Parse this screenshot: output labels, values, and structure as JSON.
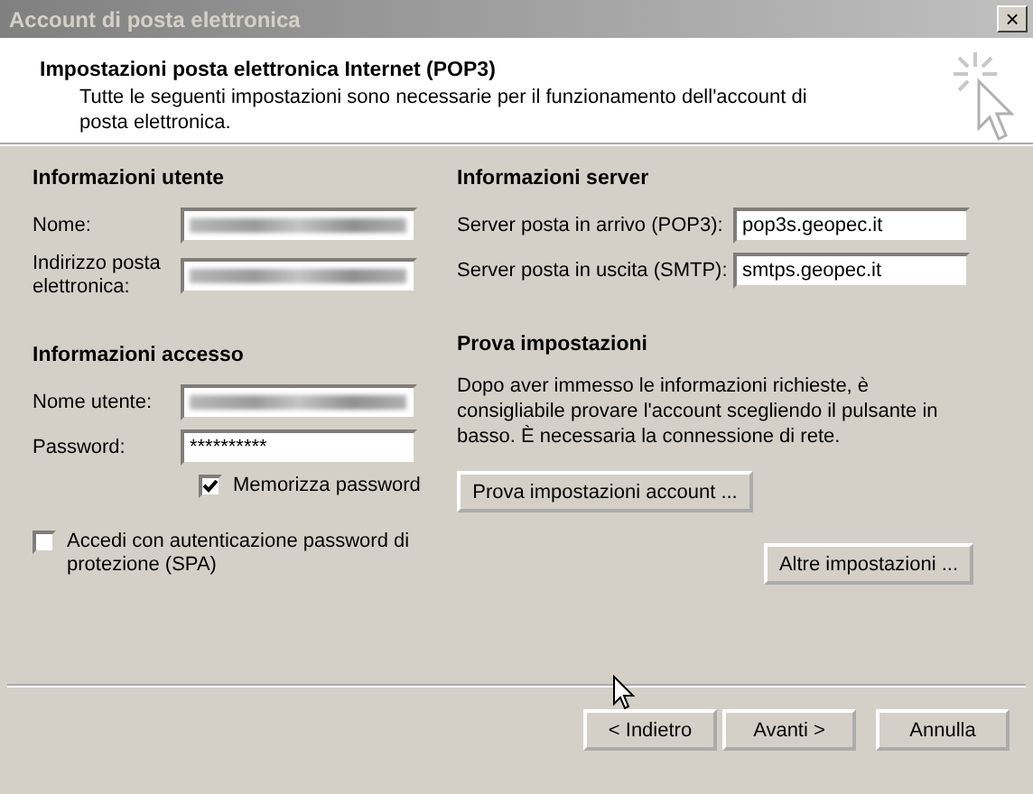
{
  "window": {
    "title": "Account di posta elettronica",
    "close": "×"
  },
  "header": {
    "title": "Impostazioni posta elettronica Internet (POP3)",
    "description": "Tutte le seguenti impostazioni sono necessarie per il funzionamento dell'account di posta elettronica."
  },
  "user_info": {
    "heading": "Informazioni utente",
    "fields": [
      {
        "label": "Nome:",
        "blurred": true
      },
      {
        "label": "Indirizzo posta elettronica:",
        "blurred": true
      }
    ]
  },
  "access_info": {
    "heading": "Informazioni accesso",
    "fields": [
      {
        "label": "Nome utente:",
        "blurred": true
      },
      {
        "label": "Password:",
        "value": "**********",
        "blurred": false
      }
    ],
    "remember": {
      "label": "Memorizza password",
      "checked": true
    }
  },
  "spa": {
    "label": "Accedi con autenticazione password di protezione (SPA)",
    "checked": false
  },
  "server_info": {
    "heading": "Informazioni server",
    "fields": [
      {
        "label": "Server posta in arrivo (POP3):",
        "value": "pop3s.geopec.it"
      },
      {
        "label": "Server posta in uscita (SMTP):",
        "value": "smtps.geopec.it"
      }
    ]
  },
  "test": {
    "heading": "Prova impostazioni",
    "text": "Dopo aver immesso le informazioni richieste, è consigliabile provare l'account scegliendo il pulsante in basso. È necessaria la connessione di rete.",
    "button": "Prova impostazioni account ..."
  },
  "more_button": "Altre impostazioni ...",
  "buttons": [
    "< Indietro",
    "Avanti >",
    "Annulla"
  ]
}
